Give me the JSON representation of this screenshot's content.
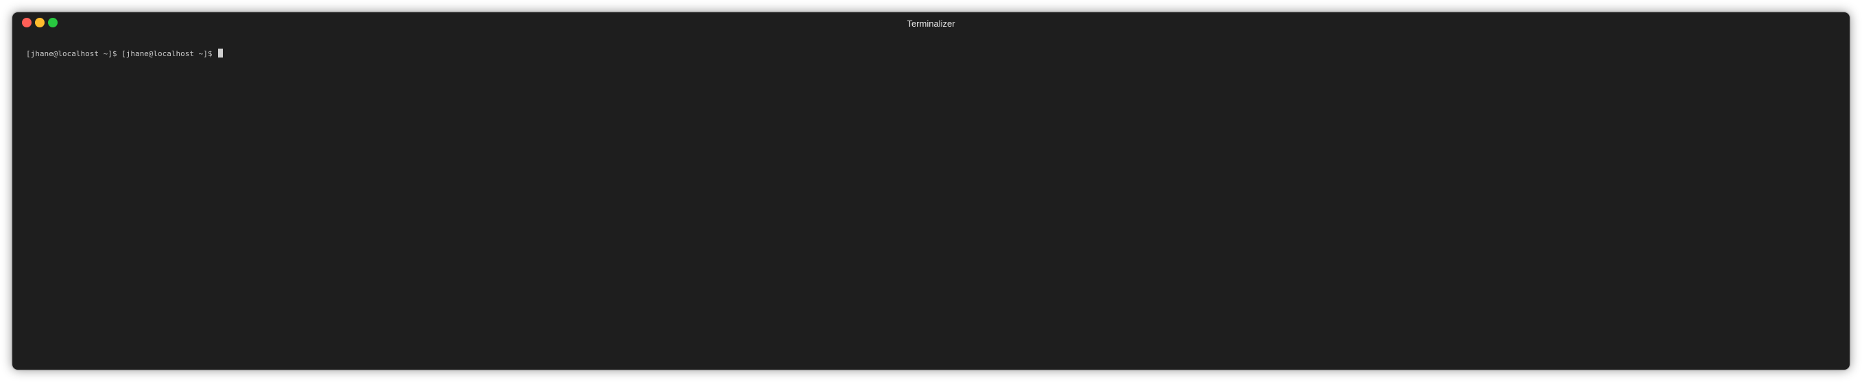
{
  "window": {
    "title": "Terminalizer",
    "colors": {
      "background": "#1e1e1e",
      "close": "#ff5f57",
      "minimize": "#febc2e",
      "maximize": "#28c840"
    }
  },
  "terminal": {
    "line": "[jhane@localhost ~]$ [jhane@localhost ~]$ ",
    "cursor_color": "#d0d0d0",
    "text_color": "#c8c8c8"
  }
}
